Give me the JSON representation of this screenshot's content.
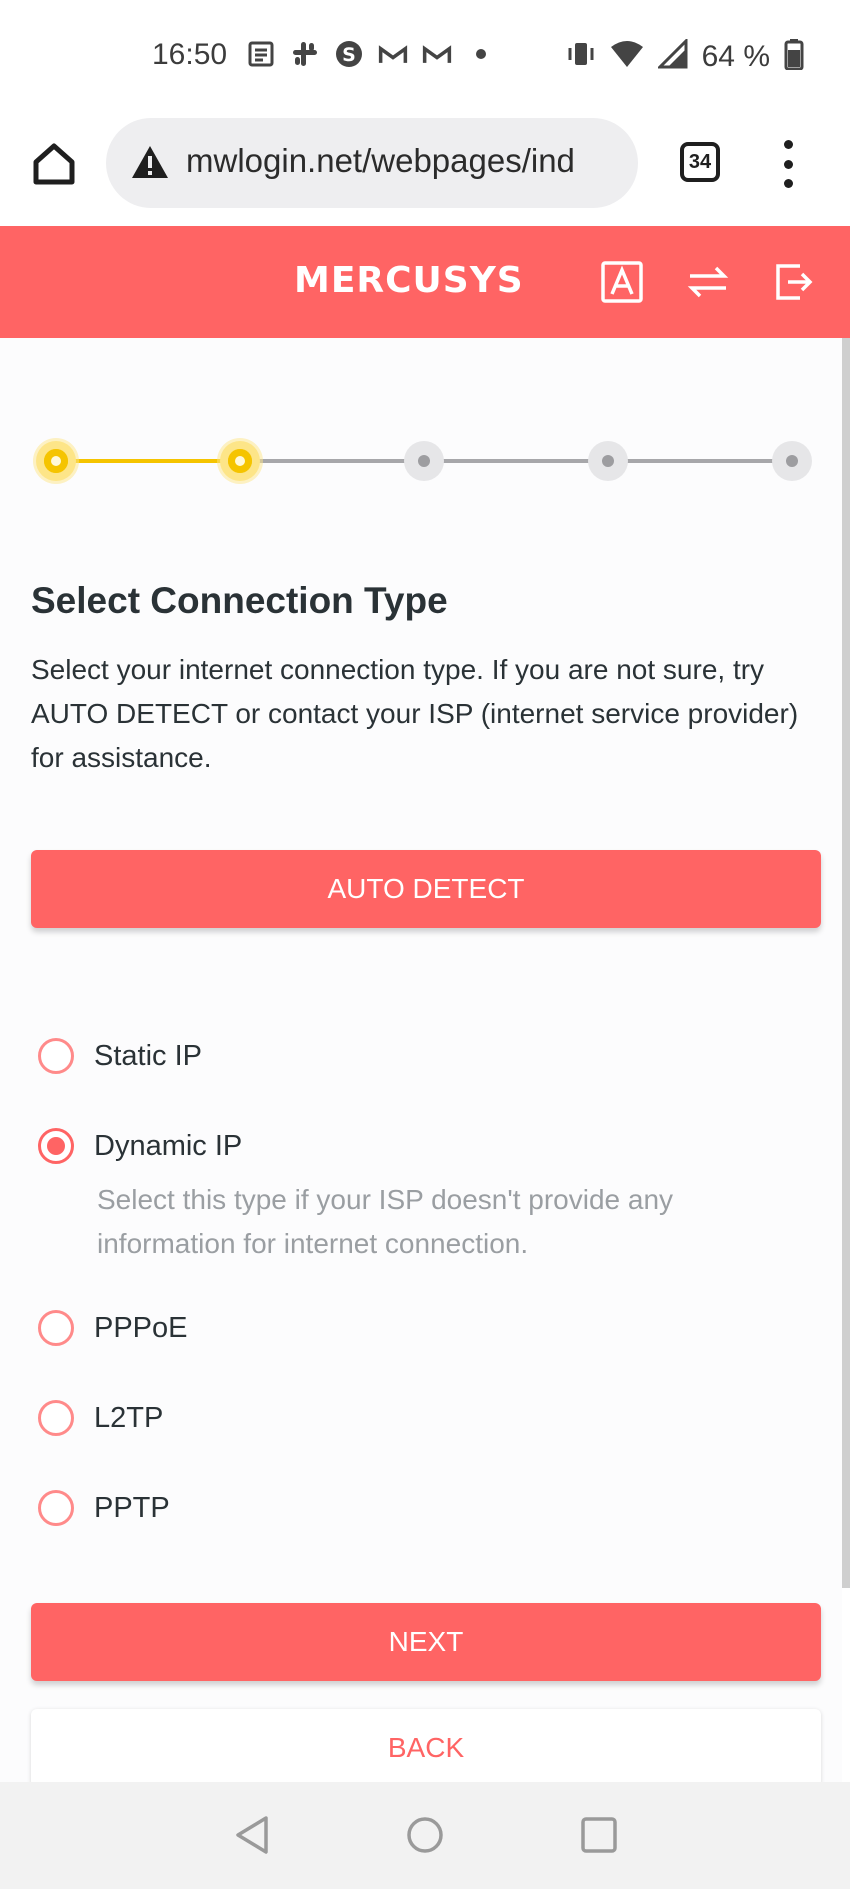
{
  "status_bar": {
    "time": "16:50",
    "battery": "64 %",
    "icons": [
      "news-icon",
      "slack-icon",
      "skype-icon",
      "gmail-icon",
      "gmail-icon",
      "dot-icon",
      "vibrate-icon",
      "wifi-icon",
      "signal-icon",
      "battery-icon"
    ]
  },
  "browser": {
    "url": "mwlogin.net/webpages/ind",
    "tab_count": "34"
  },
  "header": {
    "logo": "MERCUSYS"
  },
  "stepper": {
    "total_steps": 5,
    "completed_steps": 2
  },
  "page": {
    "title": "Select Connection Type",
    "description": "Select your internet connection type. If you are not sure, try AUTO DETECT or contact your ISP (internet service provider) for assistance.",
    "auto_detect_label": "AUTO DETECT",
    "options": [
      {
        "label": "Static IP",
        "selected": false
      },
      {
        "label": "Dynamic IP",
        "selected": true,
        "help": "Select this type if your ISP doesn't provide any information for internet connection."
      },
      {
        "label": "PPPoE",
        "selected": false
      },
      {
        "label": "L2TP",
        "selected": false
      },
      {
        "label": "PPTP",
        "selected": false
      }
    ],
    "next_label": "NEXT",
    "back_label": "BACK"
  },
  "colors": {
    "brand": "#ff6464",
    "step_active": "#f5c400",
    "step_inactive": "#9d9da0"
  }
}
